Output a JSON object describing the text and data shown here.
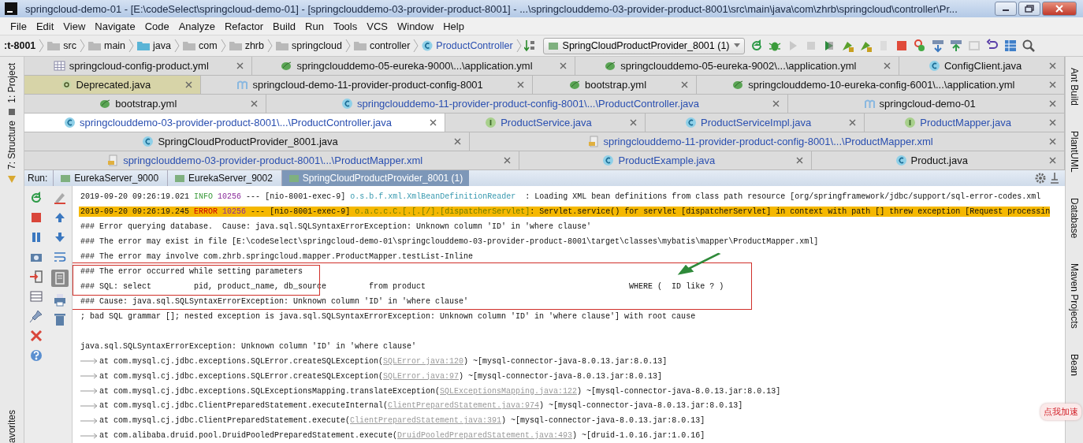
{
  "window": {
    "title": "springcloud-demo-01 - [E:\\codeSelect\\springcloud-demo-01] - [springclouddemo-03-provider-product-8001] - ...\\springclouddemo-03-provider-product-8001\\src\\main\\java\\com\\zhrb\\springcloud\\controller\\Pr..."
  },
  "menu": [
    "File",
    "Edit",
    "View",
    "Navigate",
    "Code",
    "Analyze",
    "Refactor",
    "Build",
    "Run",
    "Tools",
    "VCS",
    "Window",
    "Help"
  ],
  "breadcrumb": [
    {
      "label": ":t-8001",
      "kind": "module"
    },
    {
      "label": "src",
      "kind": "folder"
    },
    {
      "label": "main",
      "kind": "folder"
    },
    {
      "label": "java",
      "kind": "source"
    },
    {
      "label": "com",
      "kind": "package"
    },
    {
      "label": "zhrb",
      "kind": "package"
    },
    {
      "label": "springcloud",
      "kind": "package"
    },
    {
      "label": "controller",
      "kind": "package"
    },
    {
      "label": "ProductController",
      "kind": "class"
    }
  ],
  "run_config": {
    "label": "SpringCloudProductProvider_8001 (1)"
  },
  "left_tools": [
    "1: Project",
    "7: Structure",
    "avorites"
  ],
  "right_tools": [
    "Ant Build",
    "PlantUML",
    "Database",
    "Maven Projects",
    "Bean"
  ],
  "editor_tabs": [
    [
      {
        "label": "springcloud-config-product.yml",
        "kind": "table",
        "modified": false,
        "selected": false,
        "highlighted": false
      },
      {
        "label": "springclouddemo-05-eureka-9000\\...\\application.yml",
        "kind": "spring",
        "modified": false,
        "selected": false,
        "highlighted": false
      },
      {
        "label": "springclouddemo-05-eureka-9002\\...\\application.yml",
        "kind": "spring",
        "modified": false,
        "selected": false,
        "highlighted": false
      },
      {
        "label": "ConfigClient.java",
        "kind": "class",
        "modified": false,
        "selected": false,
        "highlighted": false
      }
    ],
    [
      {
        "label": "Deprecated.java",
        "kind": "annotation",
        "modified": false,
        "selected": false,
        "highlighted": true
      },
      {
        "label": "springcloud-demo-11-provider-product-config-8001",
        "kind": "maven",
        "modified": false,
        "selected": false,
        "highlighted": false
      },
      {
        "label": "bootstrap.yml",
        "kind": "spring",
        "modified": false,
        "selected": false,
        "highlighted": false
      },
      {
        "label": "springclouddemo-10-eureka-config-6001\\...\\application.yml",
        "kind": "spring",
        "modified": false,
        "selected": false,
        "highlighted": false
      }
    ],
    [
      {
        "label": "bootstrap.yml",
        "kind": "spring",
        "modified": false,
        "selected": false,
        "highlighted": false
      },
      {
        "label": "springclouddemo-11-provider-product-config-8001\\...\\ProductController.java",
        "kind": "class",
        "modified": true,
        "selected": false,
        "highlighted": false
      },
      {
        "label": "springcloud-demo-01",
        "kind": "maven",
        "modified": false,
        "selected": false,
        "highlighted": false
      }
    ],
    [
      {
        "label": "springclouddemo-03-provider-product-8001\\...\\ProductController.java",
        "kind": "class",
        "modified": true,
        "selected": true,
        "highlighted": false
      },
      {
        "label": "ProductService.java",
        "kind": "interface",
        "modified": true,
        "selected": false,
        "highlighted": false
      },
      {
        "label": "ProductServiceImpl.java",
        "kind": "class",
        "modified": true,
        "selected": false,
        "highlighted": false
      },
      {
        "label": "ProductMapper.java",
        "kind": "interface",
        "modified": true,
        "selected": false,
        "highlighted": false
      }
    ],
    [
      {
        "label": "SpringCloudProductProvider_8001.java",
        "kind": "class",
        "modified": false,
        "selected": false,
        "highlighted": false
      },
      {
        "label": "springclouddemo-11-provider-product-config-8001\\...\\ProductMapper.xml",
        "kind": "xml",
        "modified": true,
        "selected": false,
        "highlighted": false
      }
    ],
    [
      {
        "label": "springclouddemo-03-provider-product-8001\\...\\ProductMapper.xml",
        "kind": "xml",
        "modified": true,
        "selected": false,
        "highlighted": false
      },
      {
        "label": "ProductExample.java",
        "kind": "class",
        "modified": true,
        "selected": false,
        "highlighted": false
      },
      {
        "label": "Product.java",
        "kind": "class",
        "modified": false,
        "selected": false,
        "highlighted": false
      }
    ]
  ],
  "run_panel": {
    "label": "Run:",
    "tabs": [
      {
        "label": "EurekaServer_9000",
        "selected": false
      },
      {
        "label": "EurekaServer_9002",
        "selected": false
      },
      {
        "label": "SpringCloudProductProvider_8001 (1)",
        "selected": true
      }
    ]
  },
  "log": [
    {
      "kind": "entry",
      "level": "INFO",
      "time": "2019-09-20 09:26:19.021",
      "pid": "10256",
      "sep": "---",
      "thread": "[nio-8001-exec-9]",
      "logger": "o.s.b.f.xml.XmlBeanDefinitionReader",
      "message": ": Loading XML bean definitions from class path resource [org/springframework/jdbc/support/sql-error-codes.xml"
    },
    {
      "kind": "entry",
      "level": "ERROR",
      "time": "2019-09-20 09:26:19.245",
      "pid": "10256",
      "sep": "---",
      "thread": "[nio-8001-exec-9]",
      "logger": "o.a.c.c.C.[.[.[/].[dispatcherServlet]",
      "message": ": Servlet.service() for servlet [dispatcherServlet] in context with path [] threw exception [Request processin"
    },
    {
      "kind": "text",
      "text": "### Error querying database.  Cause: java.sql.SQLSyntaxErrorException: Unknown column 'ID' in 'where clause'"
    },
    {
      "kind": "text",
      "text": "### The error may exist in file [E:\\codeSelect\\springcloud-demo-01\\springclouddemo-03-provider-product-8001\\target\\classes\\mybatis\\mapper\\ProductMapper.xml]"
    },
    {
      "kind": "text",
      "text": "### The error may involve com.zhrb.springcloud.mapper.ProductMapper.testList-Inline"
    },
    {
      "kind": "text",
      "text": "### The error occurred while setting parameters"
    },
    {
      "kind": "text",
      "text": "### SQL: select         pid, product_name, db_source         from product                                           WHERE (  ID like ? )"
    },
    {
      "kind": "text",
      "text": "### Cause: java.sql.SQLSyntaxErrorException: Unknown column 'ID' in 'where clause'"
    },
    {
      "kind": "text",
      "text": "; bad SQL grammar []; nested exception is java.sql.SQLSyntaxErrorException: Unknown column 'ID' in 'where clause'] with root cause"
    },
    {
      "kind": "blank"
    },
    {
      "kind": "text",
      "text": "java.sql.SQLSyntaxErrorException: Unknown column 'ID' in 'where clause'"
    },
    {
      "kind": "stack",
      "text": "at com.mysql.cj.jdbc.exceptions.SQLError.createSQLException(",
      "link": "SQLError.java:120",
      "tail": ") ~[mysql-connector-java-8.0.13.jar:8.0.13]"
    },
    {
      "kind": "stack",
      "text": "at com.mysql.cj.jdbc.exceptions.SQLError.createSQLException(",
      "link": "SQLError.java:97",
      "tail": ") ~[mysql-connector-java-8.0.13.jar:8.0.13]"
    },
    {
      "kind": "stack",
      "text": "at com.mysql.cj.jdbc.exceptions.SQLExceptionsMapping.translateException(",
      "link": "SQLExceptionsMapping.java:122",
      "tail": ") ~[mysql-connector-java-8.0.13.jar:8.0.13]"
    },
    {
      "kind": "stack",
      "text": "at com.mysql.cj.jdbc.ClientPreparedStatement.executeInternal(",
      "link": "ClientPreparedStatement.java:974",
      "tail": ") ~[mysql-connector-java-8.0.13.jar:8.0.13]"
    },
    {
      "kind": "stack",
      "text": "at com.mysql.cj.jdbc.ClientPreparedStatement.execute(",
      "link": "ClientPreparedStatement.java:391",
      "tail": ") ~[mysql-connector-java-8.0.13.jar:8.0.13]"
    },
    {
      "kind": "stack",
      "text": "at com.alibaba.druid.pool.DruidPooledPreparedStatement.execute(",
      "link": "DruidPooledPreparedStatement.java:493",
      "tail": ") ~[druid-1.0.16.jar:1.0.16]"
    }
  ],
  "badge": {
    "label": "点我加速"
  }
}
